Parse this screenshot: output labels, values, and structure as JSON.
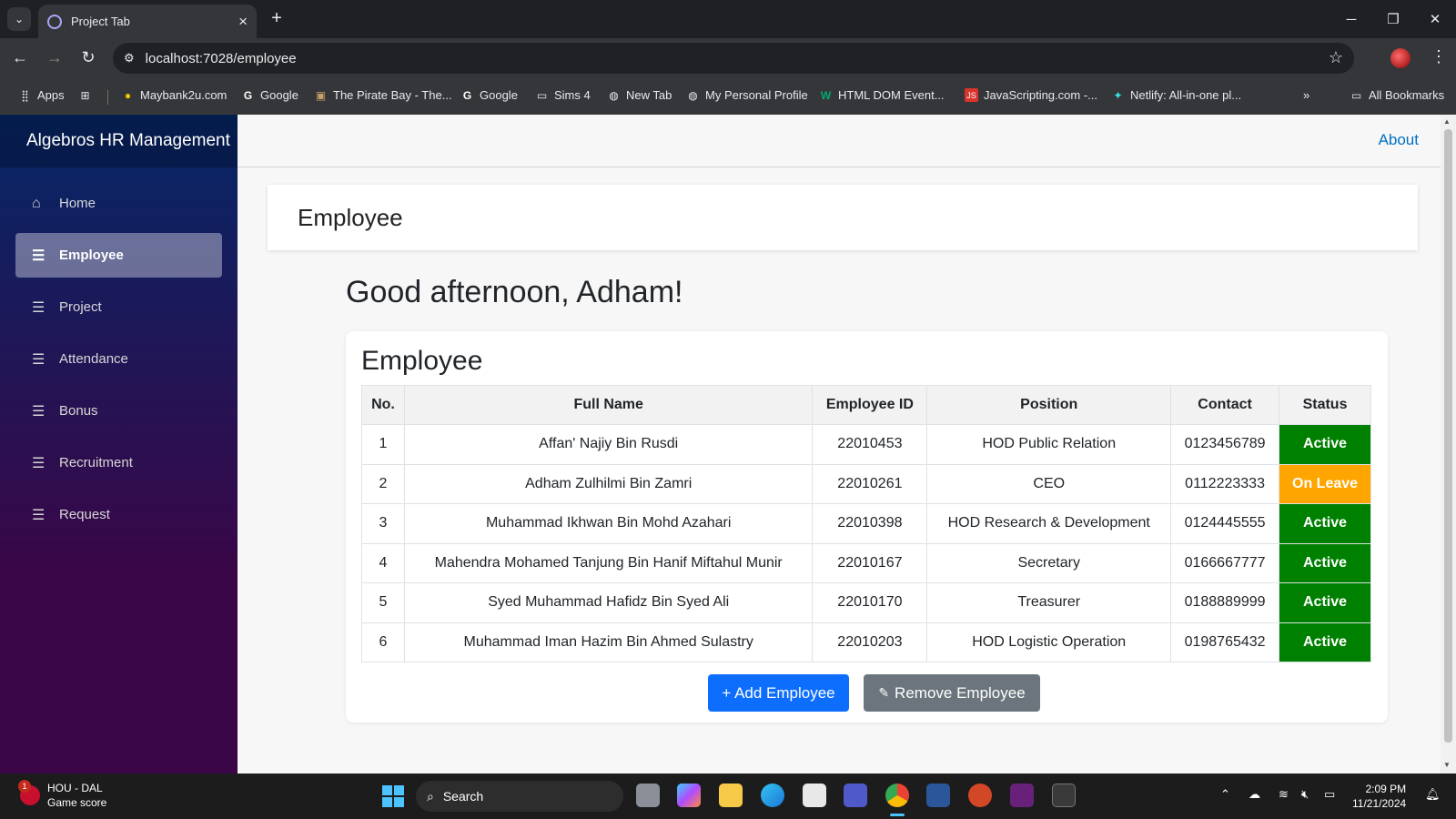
{
  "browser": {
    "tab_title": "Project Tab",
    "url": "localhost:7028/employee",
    "bookmarks": [
      {
        "label": "Apps",
        "icon": "apps-grid-icon"
      },
      {
        "label": "Maybank2u.com",
        "icon": "maybank-icon"
      },
      {
        "label": "Google",
        "icon": "google-icon"
      },
      {
        "label": "The Pirate Bay - The...",
        "icon": "pirate-bay-icon"
      },
      {
        "label": "Google",
        "icon": "google-icon"
      },
      {
        "label": "Sims 4",
        "icon": "folder-icon"
      },
      {
        "label": "New Tab",
        "icon": "globe-icon"
      },
      {
        "label": "My Personal Profile",
        "icon": "globe-icon"
      },
      {
        "label": "HTML DOM Event...",
        "icon": "w3schools-icon"
      },
      {
        "label": "JavaScripting.com -...",
        "icon": "javascripting-icon"
      },
      {
        "label": "Netlify: All-in-one pl...",
        "icon": "netlify-icon"
      }
    ],
    "all_bookmarks": "All Bookmarks"
  },
  "app": {
    "brand": "Algebros HR Management",
    "about": "About",
    "nav": [
      {
        "label": "Home",
        "icon": "home-icon"
      },
      {
        "label": "Employee",
        "icon": "list-icon",
        "active": true
      },
      {
        "label": "Project",
        "icon": "list-icon"
      },
      {
        "label": "Attendance",
        "icon": "list-icon"
      },
      {
        "label": "Bonus",
        "icon": "list-icon"
      },
      {
        "label": "Recruitment",
        "icon": "list-icon"
      },
      {
        "label": "Request",
        "icon": "list-icon"
      }
    ],
    "page_title": "Employee",
    "greeting": "Good afternoon, Adham!",
    "card_title": "Employee",
    "table": {
      "headers": [
        "No.",
        "Full Name",
        "Employee ID",
        "Position",
        "Contact",
        "Status"
      ],
      "rows": [
        [
          "1",
          "Affan' Najiy Bin Rusdi",
          "22010453",
          "HOD Public Relation",
          "0123456789",
          "Active"
        ],
        [
          "2",
          "Adham Zulhilmi Bin Zamri",
          "22010261",
          "CEO",
          "0112223333",
          "On Leave"
        ],
        [
          "3",
          "Muhammad Ikhwan Bin Mohd Azahari",
          "22010398",
          "HOD Research & Development",
          "0124445555",
          "Active"
        ],
        [
          "4",
          "Mahendra Mohamed Tanjung Bin Hanif Miftahul Munir",
          "22010167",
          "Secretary",
          "0166667777",
          "Active"
        ],
        [
          "5",
          "Syed Muhammad Hafidz Bin Syed Ali",
          "22010170",
          "Treasurer",
          "0188889999",
          "Active"
        ],
        [
          "6",
          "Muhammad Iman Hazim Bin Ahmed Sulastry",
          "22010203",
          "HOD Logistic Operation",
          "0198765432",
          "Active"
        ]
      ]
    },
    "buttons": {
      "add": "+ Add Employee",
      "remove": "Remove Employee"
    },
    "colors": {
      "active": "#008000",
      "on_leave": "#ffa500",
      "primary": "#0d6efd",
      "secondary": "#6c757d"
    }
  },
  "taskbar": {
    "widget_title": "HOU - DAL",
    "widget_subtitle": "Game score",
    "widget_badge": "1",
    "search_placeholder": "Search",
    "time": "2:09 PM",
    "date": "11/21/2024"
  }
}
